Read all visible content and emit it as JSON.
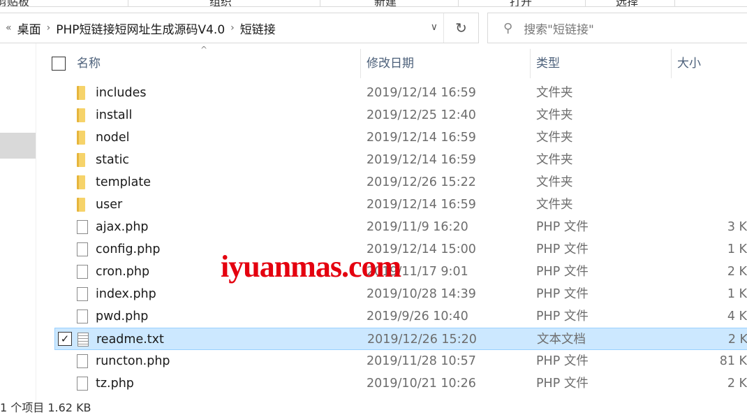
{
  "ribbon": {
    "items": [
      "剪贴板",
      "组织",
      "新建",
      "打开",
      "选择"
    ]
  },
  "address": {
    "back_chevron": "«",
    "path": [
      "桌面",
      "PHP短链接短网址生成源码V4.0",
      "短链接"
    ],
    "dropdown": "∨",
    "refresh": "↻"
  },
  "search": {
    "placeholder": "搜索\"短链接\"",
    "icon": "search-icon"
  },
  "columns": {
    "name": "名称",
    "date": "修改日期",
    "type": "类型",
    "size": "大小",
    "sort_indicator": "^"
  },
  "files": [
    {
      "name": "includes",
      "date": "2019/12/14 16:59",
      "type": "文件夹",
      "size": "",
      "kind": "folder"
    },
    {
      "name": "install",
      "date": "2019/12/25 12:40",
      "type": "文件夹",
      "size": "",
      "kind": "folder"
    },
    {
      "name": "nodel",
      "date": "2019/12/14 16:59",
      "type": "文件夹",
      "size": "",
      "kind": "folder"
    },
    {
      "name": "static",
      "date": "2019/12/14 16:59",
      "type": "文件夹",
      "size": "",
      "kind": "folder"
    },
    {
      "name": "template",
      "date": "2019/12/26 15:22",
      "type": "文件夹",
      "size": "",
      "kind": "folder"
    },
    {
      "name": "user",
      "date": "2019/12/14 16:59",
      "type": "文件夹",
      "size": "",
      "kind": "folder"
    },
    {
      "name": "ajax.php",
      "date": "2019/11/9 16:20",
      "type": "PHP 文件",
      "size": "3 K",
      "kind": "file"
    },
    {
      "name": "config.php",
      "date": "2019/12/14 15:00",
      "type": "PHP 文件",
      "size": "1 K",
      "kind": "file"
    },
    {
      "name": "cron.php",
      "date": "2019/11/17 9:01",
      "type": "PHP 文件",
      "size": "2 K",
      "kind": "file"
    },
    {
      "name": "index.php",
      "date": "2019/10/28 14:39",
      "type": "PHP 文件",
      "size": "1 K",
      "kind": "file"
    },
    {
      "name": "pwd.php",
      "date": "2019/9/26 10:40",
      "type": "PHP 文件",
      "size": "4 K",
      "kind": "file"
    },
    {
      "name": "readme.txt",
      "date": "2019/12/26 15:20",
      "type": "文本文档",
      "size": "2 K",
      "kind": "txt",
      "selected": true,
      "check": "✓"
    },
    {
      "name": "runcton.php",
      "date": "2019/11/28 10:57",
      "type": "PHP 文件",
      "size": "81 K",
      "kind": "file"
    },
    {
      "name": "tz.php",
      "date": "2019/10/21 10:26",
      "type": "PHP 文件",
      "size": "2 K",
      "kind": "file"
    }
  ],
  "status": {
    "text": "1 个项目  1.62 KB"
  },
  "watermark": "iyuanmas.com",
  "colors": {
    "selection": "#cce8ff",
    "watermark": "#e4000f"
  }
}
